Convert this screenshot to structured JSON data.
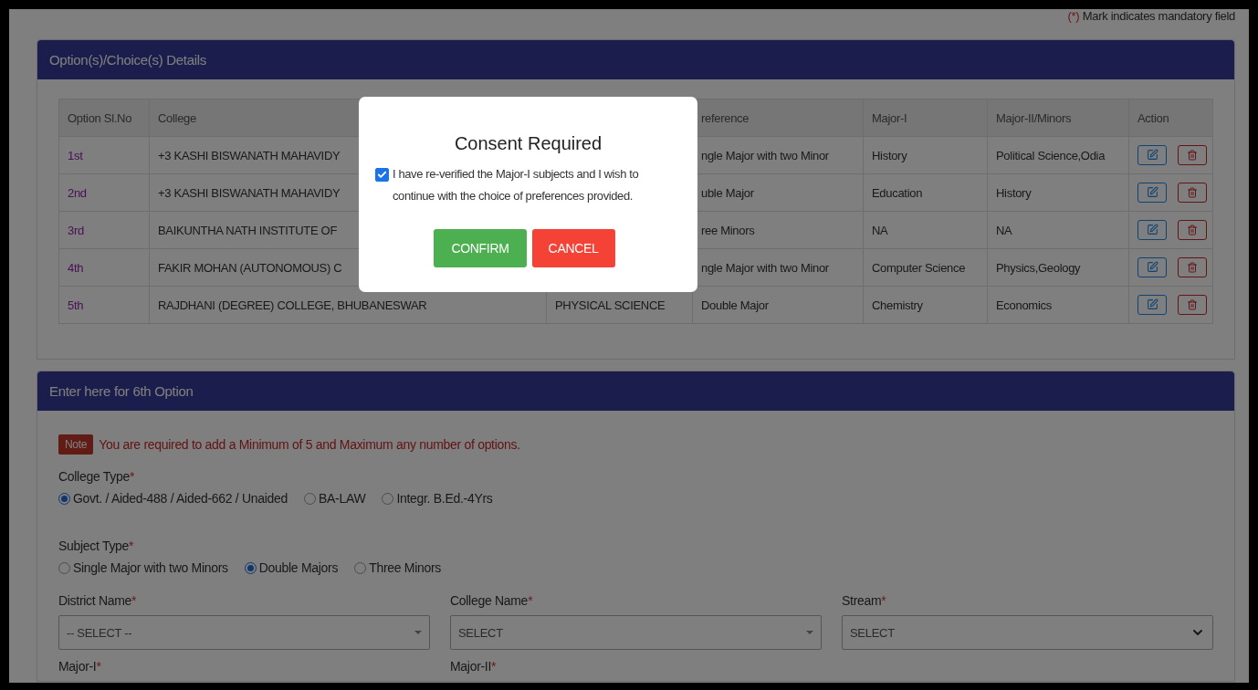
{
  "mandatory_note": {
    "mark": "(*)",
    "text": "Mark indicates mandatory field"
  },
  "options_panel": {
    "title": "Option(s)/Choice(s) Details",
    "columns": {
      "option_sl_no": "Option Sl.No",
      "college": "College",
      "preference": "reference",
      "major_1": "Major-I",
      "major_2": "Major-II/Minors",
      "action": "Action"
    },
    "rows": [
      {
        "option_no": "1st",
        "college": "+3 KASHI BISWANATH MAHAVIDY",
        "preference": "ngle Major with two Minor",
        "major_1": "History",
        "major_2": "Political Science,Odia"
      },
      {
        "option_no": "2nd",
        "college": "+3 KASHI BISWANATH MAHAVIDY",
        "preference": "uble Major",
        "major_1": "Education",
        "major_2": "History"
      },
      {
        "option_no": "3rd",
        "college": "BAIKUNTHA NATH INSTITUTE OF",
        "preference": "ree Minors",
        "major_1": "NA",
        "major_2": "NA"
      },
      {
        "option_no": "4th",
        "college": "FAKIR MOHAN (AUTONOMOUS) C",
        "preference": "ngle Major with two Minor",
        "major_1": "Computer Science",
        "major_2": "Physics,Geology"
      },
      {
        "option_no": "5th",
        "college": "RAJDHANI (DEGREE) COLLEGE, BHUBANESWAR",
        "column_3": "PHYSICAL SCIENCE",
        "preference": "Double Major",
        "major_1": "Chemistry",
        "major_2": "Economics"
      }
    ]
  },
  "entry_panel": {
    "title": "Enter here for 6th Option",
    "note": {
      "badge": "Note",
      "text": "You are required to add a Minimum of 5 and Maximum any number of options."
    },
    "radio_groups": [
      {
        "label": "College Type",
        "mark": "*",
        "options": [
          {
            "label": "Govt. / Aided-488 / Aided-662 / Unaided",
            "selected": true
          },
          {
            "label": "BA-LAW",
            "selected": false
          },
          {
            "label": "Integr. B.Ed.-4Yrs",
            "selected": false
          }
        ]
      },
      {
        "label": "Subject Type",
        "mark": "*",
        "options": [
          {
            "label": "Single Major with two Minors",
            "selected": false
          },
          {
            "label": "Double Majors",
            "selected": true
          },
          {
            "label": "Three Minors",
            "selected": false
          }
        ]
      }
    ],
    "selects": [
      {
        "label": "District Name",
        "mark": "*",
        "value": "-- SELECT --",
        "kind": "searchable"
      },
      {
        "label": "College Name",
        "mark": "*",
        "value": "SELECT",
        "kind": "searchable"
      },
      {
        "label": "Stream",
        "mark": "*",
        "value": "SELECT",
        "kind": "native"
      }
    ],
    "next_labels": [
      {
        "label": "Major-I",
        "mark": "*"
      },
      {
        "label": "Major-II",
        "mark": "*"
      }
    ]
  },
  "modal": {
    "title": "Consent Required",
    "consent": {
      "checked": true,
      "text": "I have re-verified the Major-I subjects and I wish to continue with the choice of preferences provided."
    },
    "buttons": [
      {
        "kind": "confirm",
        "label": "CONFIRM"
      },
      {
        "kind": "cancel",
        "label": "CANCEL"
      }
    ]
  }
}
